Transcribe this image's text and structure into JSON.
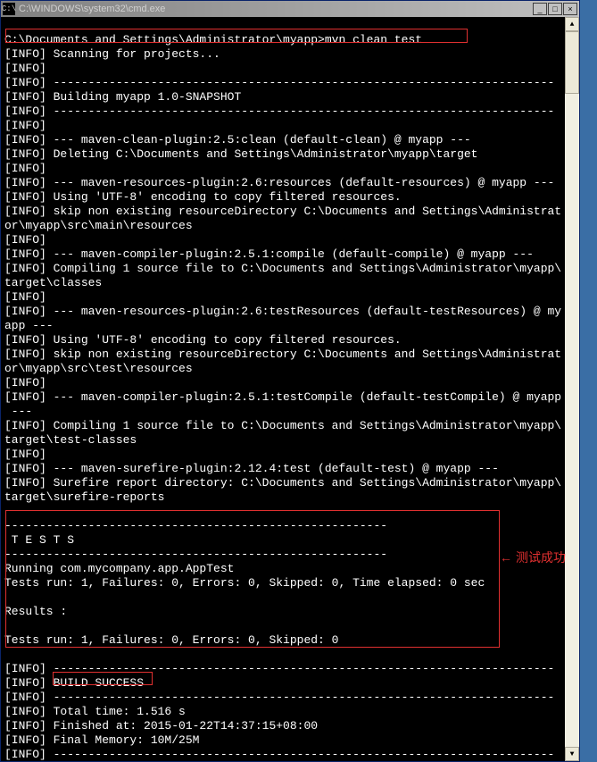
{
  "window": {
    "title": "C:\\WINDOWS\\system32\\cmd.exe",
    "icon_glyph": "C:\\"
  },
  "buttons": {
    "min": "_",
    "max": "□",
    "close": "×"
  },
  "scroll": {
    "up": "▲",
    "down": "▼"
  },
  "prompt": "C:\\Documents and Settings\\Administrator\\myapp>",
  "command": "mvn clean test",
  "lines": [
    "",
    "C:\\Documents and Settings\\Administrator\\myapp>mvn clean test",
    "[INFO] Scanning for projects...",
    "[INFO]",
    "[INFO] ------------------------------------------------------------------------",
    "[INFO] Building myapp 1.0-SNAPSHOT",
    "[INFO] ------------------------------------------------------------------------",
    "[INFO]",
    "[INFO] --- maven-clean-plugin:2.5:clean (default-clean) @ myapp ---",
    "[INFO] Deleting C:\\Documents and Settings\\Administrator\\myapp\\target",
    "[INFO]",
    "[INFO] --- maven-resources-plugin:2.6:resources (default-resources) @ myapp ---",
    "[INFO] Using 'UTF-8' encoding to copy filtered resources.",
    "[INFO] skip non existing resourceDirectory C:\\Documents and Settings\\Administrat",
    "or\\myapp\\src\\main\\resources",
    "[INFO]",
    "[INFO] --- maven-compiler-plugin:2.5.1:compile (default-compile) @ myapp ---",
    "[INFO] Compiling 1 source file to C:\\Documents and Settings\\Administrator\\myapp\\",
    "target\\classes",
    "[INFO]",
    "[INFO] --- maven-resources-plugin:2.6:testResources (default-testResources) @ my",
    "app ---",
    "[INFO] Using 'UTF-8' encoding to copy filtered resources.",
    "[INFO] skip non existing resourceDirectory C:\\Documents and Settings\\Administrat",
    "or\\myapp\\src\\test\\resources",
    "[INFO]",
    "[INFO] --- maven-compiler-plugin:2.5.1:testCompile (default-testCompile) @ myapp",
    " ---",
    "[INFO] Compiling 1 source file to C:\\Documents and Settings\\Administrator\\myapp\\",
    "target\\test-classes",
    "[INFO]",
    "[INFO] --- maven-surefire-plugin:2.12.4:test (default-test) @ myapp ---",
    "[INFO] Surefire report directory: C:\\Documents and Settings\\Administrator\\myapp\\",
    "target\\surefire-reports",
    "",
    "-------------------------------------------------------",
    " T E S T S",
    "-------------------------------------------------------",
    "Running com.mycompany.app.AppTest",
    "Tests run: 1, Failures: 0, Errors: 0, Skipped: 0, Time elapsed: 0 sec",
    "",
    "Results :",
    "",
    "Tests run: 1, Failures: 0, Errors: 0, Skipped: 0",
    "",
    "[INFO] ------------------------------------------------------------------------",
    "[INFO] BUILD SUCCESS",
    "[INFO] ------------------------------------------------------------------------",
    "[INFO] Total time: 1.516 s",
    "[INFO] Finished at: 2015-01-22T14:37:15+08:00",
    "[INFO] Final Memory: 10M/25M",
    "[INFO] ------------------------------------------------------------------------"
  ],
  "annotation": {
    "arrow": "←",
    "text": "测试成功"
  }
}
